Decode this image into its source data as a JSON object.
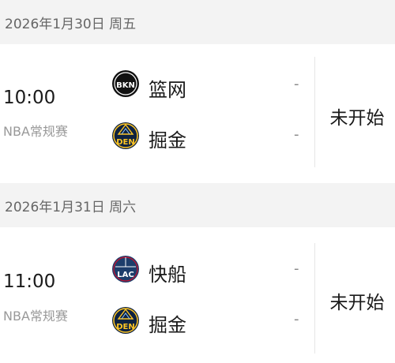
{
  "days": [
    {
      "date": "2026年1月30日 周五",
      "match": {
        "time": "10:00",
        "league": "NBA常规赛",
        "status": "未开始",
        "home": {
          "name": "篮网",
          "logo_text": "BKN",
          "logo_icon": "nets-logo-icon",
          "score": "-"
        },
        "away": {
          "name": "掘金",
          "logo_text": "DEN",
          "logo_icon": "nuggets-logo-icon",
          "score": "-"
        }
      }
    },
    {
      "date": "2026年1月31日 周六",
      "match": {
        "time": "11:00",
        "league": "NBA常规赛",
        "status": "未开始",
        "home": {
          "name": "快船",
          "logo_text": "LAC",
          "logo_icon": "clippers-logo-icon",
          "score": "-"
        },
        "away": {
          "name": "掘金",
          "logo_text": "DEN",
          "logo_icon": "nuggets-logo-icon",
          "score": "-"
        }
      }
    }
  ],
  "colors": {
    "header_bg": "#f3f3f3",
    "nets": "#111111",
    "nuggets_navy": "#0e2240",
    "nuggets_gold": "#fec524",
    "clippers_navy": "#1d3d6b"
  }
}
